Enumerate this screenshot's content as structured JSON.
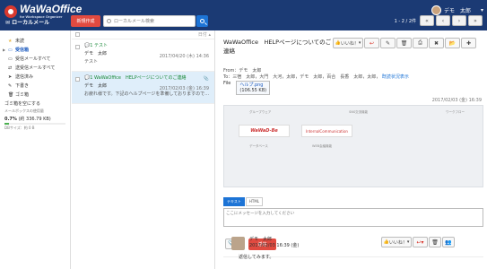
{
  "app": {
    "logo_title": "WaWaOffice",
    "logo_subtitle": "for Workspace Organizer",
    "user_name": "デモ　太郎"
  },
  "toolbar": {
    "local_mail": "ローカルメール",
    "new_button": "新規作成",
    "search_placeholder": "ローカルメール検索",
    "pager_count": "1 - 2 / 2件"
  },
  "sidebar": {
    "folders": [
      {
        "label": "未読",
        "icon": "star-icon"
      },
      {
        "label": "受信箱",
        "icon": "inbox-icon",
        "active": true
      },
      {
        "label": "受信メールすべて",
        "icon": "inbox-all-icon"
      },
      {
        "label": "送受信メールすべて",
        "icon": "mail-all-icon"
      },
      {
        "label": "送信済み",
        "icon": "send-icon"
      },
      {
        "label": "下書き",
        "icon": "draft-icon"
      },
      {
        "label": "ゴミ箱",
        "icon": "trash-icon"
      }
    ],
    "empty_trash": "ゴミ箱を空にする",
    "storage_label": "メールボックスの使用量",
    "storage_usage": "0.7%",
    "storage_detail": "(約 336.79 KB)",
    "storage_fraction": 0.007,
    "db_size": "DBサイズ：約 0 B"
  },
  "list": {
    "header_sort": "日付 ▴",
    "items": [
      {
        "subject": "テスト",
        "unread_count": "1",
        "from": "デモ　太郎",
        "date": "2017/04/20 (木) 14:36",
        "preview": "テスト"
      },
      {
        "subject": "WaWaOffice　HELPページについてのご連絡",
        "unread_count": "1",
        "from": "デモ　太郎",
        "date": "2017/02/03 (金) 16:39",
        "preview": "お疲れ様です。下記のヘルプページを準備しておりますのでご確認",
        "selected": true
      }
    ]
  },
  "viewer": {
    "subject": "WaWaOffice　HELPページについてのご連絡",
    "like_label": "いいね！",
    "from_line": "From：デモ　太郎",
    "to_line": "To：三宿　太郎，大門　大河，太郎，デモ　太郎，百合　長香　太郎，太郎，",
    "to_link": "既読状況表示",
    "file_label": "File",
    "file_name": "ヘルプ.png",
    "file_size": "(106.55 KB)",
    "date": "2017/02/03 (金) 16:39",
    "preview": {
      "headers": [
        "グループウェア",
        "SNS交流機能",
        "ワークフロー"
      ],
      "card1": "WaWaD-Be",
      "card2": "InternalCommunication",
      "sub1": "データベース",
      "sub2": "WEB会議機能"
    },
    "compose_tabs": [
      "テキスト",
      "HTML"
    ],
    "compose_placeholder": "ここにメッセージを入力してください",
    "send_button": "返信",
    "reply": {
      "from": "デモ　太郎",
      "date": "2017/02/03 16:39 (金)",
      "body": "返信してみます。",
      "like_label": "いいね！"
    }
  }
}
